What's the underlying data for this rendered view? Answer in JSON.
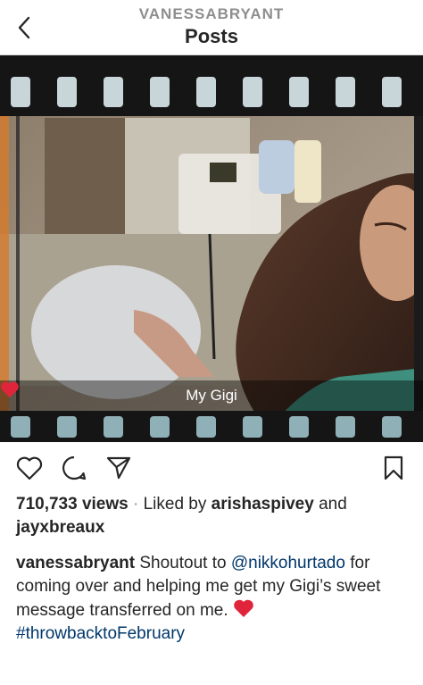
{
  "header": {
    "username": "VANESSABRYANT",
    "title": "Posts"
  },
  "photo": {
    "overlay_text": "My Gigi"
  },
  "stats": {
    "views": "710,733 views",
    "separator": "·",
    "liked_by_prefix": "Liked by",
    "liker_1": "arishaspivey",
    "and_word": "and",
    "liker_2": "jayxbreaux"
  },
  "caption": {
    "author": "vanessabryant",
    "text_1": "Shoutout to",
    "mention": "@nikkohurtado",
    "text_2": "for coming over and helping me get my Gigi’s sweet message transferred on me.",
    "hashtag": "#throwbacktoFebruary"
  },
  "colors": {
    "heart": "#e0243b",
    "link": "#00376b"
  },
  "icons": {
    "back": "chevron-left-icon",
    "like": "heart-outline-icon",
    "comment": "comment-icon",
    "share": "send-icon",
    "save": "bookmark-icon"
  }
}
